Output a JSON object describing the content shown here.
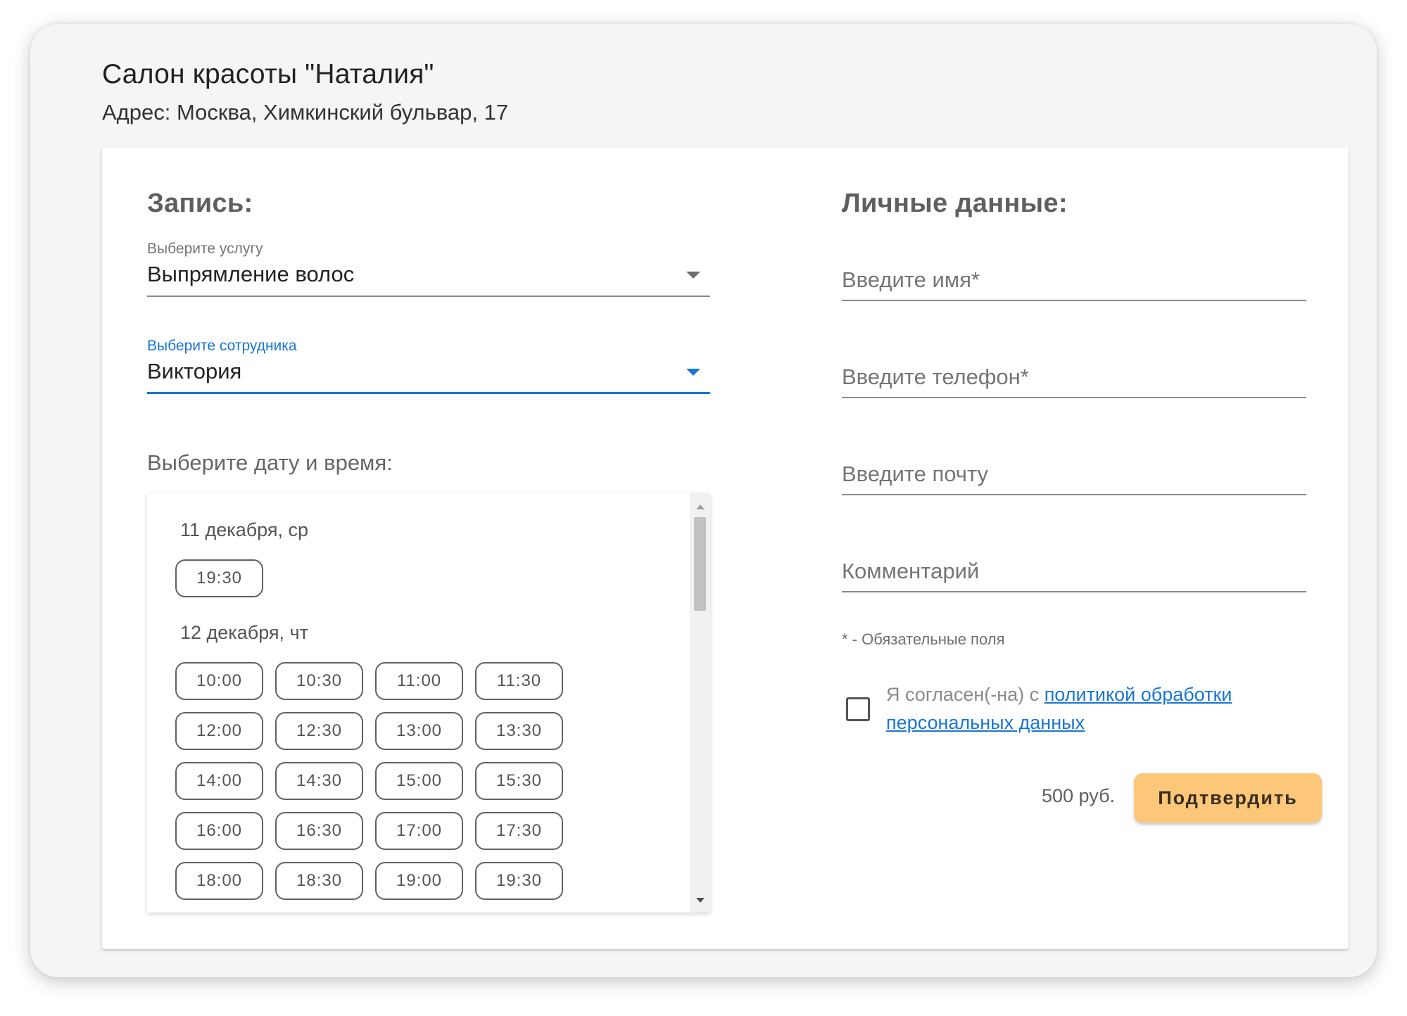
{
  "salon": {
    "title": "Салон красоты \"Наталия\"",
    "address": "Адрес: Москва, Химкинский бульвар, 17"
  },
  "booking": {
    "title": "Запись:",
    "service": {
      "label": "Выберите услугу",
      "value": "Выпрямление волос"
    },
    "employee": {
      "label": "Выберите сотрудника",
      "value": "Виктория"
    },
    "datetime_label": "Выберите дату и время:",
    "days": [
      {
        "label": "11 декабря, ср",
        "slots": [
          "19:30"
        ]
      },
      {
        "label": "12 декабря, чт",
        "slots": [
          "10:00",
          "10:30",
          "11:00",
          "11:30",
          "12:00",
          "12:30",
          "13:00",
          "13:30",
          "14:00",
          "14:30",
          "15:00",
          "15:30",
          "16:00",
          "16:30",
          "17:00",
          "17:30",
          "18:00",
          "18:30",
          "19:00",
          "19:30"
        ]
      }
    ]
  },
  "personal": {
    "title": "Личные данные:",
    "name_placeholder": "Введите имя*",
    "phone_placeholder": "Введите телефон*",
    "email_placeholder": "Введите почту",
    "comment_placeholder": "Комментарий",
    "required_note": "* - Обязательные поля",
    "consent_text": "Я согласен(-на) с ",
    "consent_link": "политикой обработки персональных данных",
    "price": "500 руб.",
    "confirm_label": "Подтвердить"
  },
  "colors": {
    "accent": "#1976d2",
    "confirm_button": "#fcc779",
    "card": "#ffffff",
    "window": "#f5f5f5"
  },
  "icons": {
    "select_caret": "chevron-down-icon",
    "scroll_up": "scroll-up-arrow-icon",
    "scroll_down": "scroll-down-arrow-icon"
  }
}
